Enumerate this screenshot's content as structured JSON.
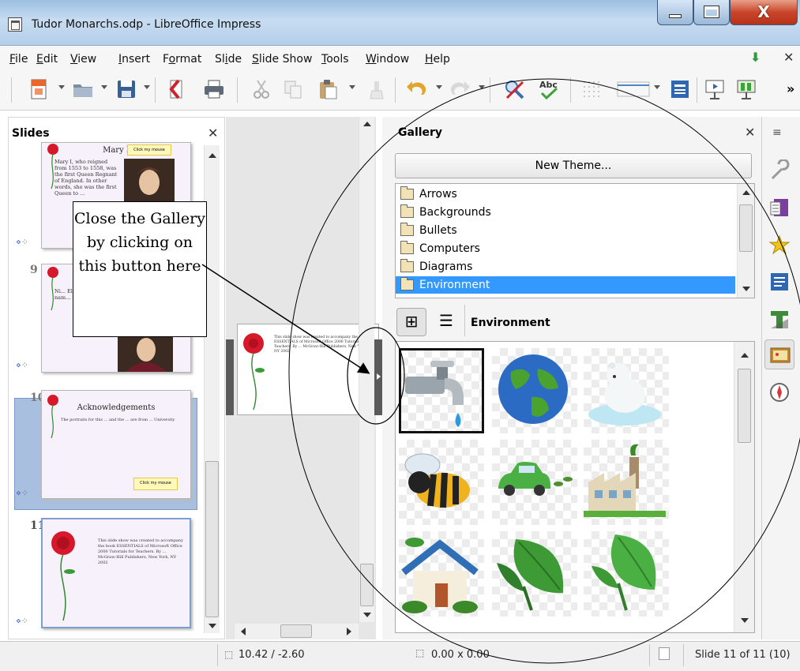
{
  "window": {
    "title": "Tudor Monarchs.odp - LibreOffice Impress"
  },
  "menu": {
    "items": [
      {
        "pre": "",
        "key": "F",
        "post": "ile"
      },
      {
        "pre": "",
        "key": "E",
        "post": "dit"
      },
      {
        "pre": "",
        "key": "V",
        "post": "iew"
      },
      {
        "pre": "",
        "key": "I",
        "post": "nsert"
      },
      {
        "pre": "F",
        "key": "o",
        "post": "rmat"
      },
      {
        "pre": "Sl",
        "key": "i",
        "post": "de"
      },
      {
        "pre": "",
        "key": "S",
        "post": "lide Show"
      },
      {
        "pre": "",
        "key": "T",
        "post": "ools"
      },
      {
        "pre": "",
        "key": "W",
        "post": "indow"
      },
      {
        "pre": "",
        "key": "H",
        "post": "elp"
      }
    ],
    "close_glyph": "✕"
  },
  "toolbar": {
    "overflow": "»"
  },
  "slides_panel": {
    "title": "Slides",
    "close": "✕",
    "slides": [
      {
        "number": "",
        "title": "Mary I",
        "button": "Click my mouse",
        "text": "Mary I, who reigned from 1553 to 1558, was the first Queen Regnant of England. In other words, she was the first Queen to ..."
      },
      {
        "number": "9",
        "title": "",
        "button": "",
        "text": "Ni... Eli... lon... mo... nam... maj... ... till 2016!)"
      },
      {
        "number": "10",
        "title": "Acknowledgements",
        "button": "Click my mouse",
        "text": "The portraits for this ... and the ... are from ... University"
      },
      {
        "number": "11",
        "title": "",
        "button": "",
        "text": "This slide show was created to accompany the book ESSENTIALS of Microsoft Office 2000 Tutorials for Teachers. By ... McGraw-Hill Publishers, New York, NY 2002"
      }
    ]
  },
  "gallery": {
    "title": "Gallery",
    "close": "✕",
    "new_theme": "New Theme...",
    "themes": [
      "Arrows",
      "Backgrounds",
      "Bullets",
      "Computers",
      "Diagrams",
      "Environment"
    ],
    "selected_theme": "Environment",
    "current_theme_label": "Environment",
    "icons": [
      "tap-water-icon",
      "globe-icon",
      "polar-bear-icon",
      "bee-icon",
      "green-car-icon",
      "factory-icon",
      "eco-house-icon",
      "leaf-icon",
      "leaf-icon"
    ]
  },
  "status": {
    "position": "10.42 / -2.60",
    "size": "0.00 x 0.00",
    "slide": "Slide 11 of 11 (10)"
  },
  "annotation": {
    "text": "Close the Gallery by clicking on this button here"
  }
}
